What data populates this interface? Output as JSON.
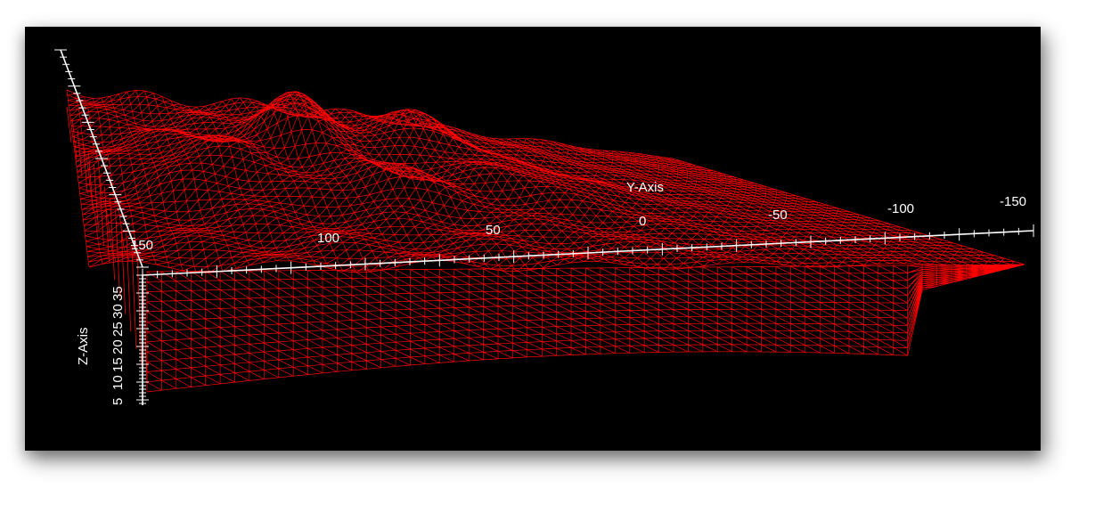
{
  "colors": {
    "background": "#000000",
    "surface": "#ff0000",
    "axes": "#ffffff"
  },
  "chart_data": {
    "type": "surface-wireframe-3d",
    "title": "",
    "y_axis": {
      "label": "Y-Axis",
      "ticks": [
        "150",
        "100",
        "50",
        "0",
        "-50",
        "-100",
        "-150"
      ]
    },
    "z_axis": {
      "label": "Z-Axis",
      "ticks": [
        "5",
        "10",
        "15",
        "20",
        "25",
        "30",
        "35"
      ]
    },
    "x_axis": {
      "label": "",
      "ticks": []
    },
    "grid": false,
    "legend": "none"
  }
}
